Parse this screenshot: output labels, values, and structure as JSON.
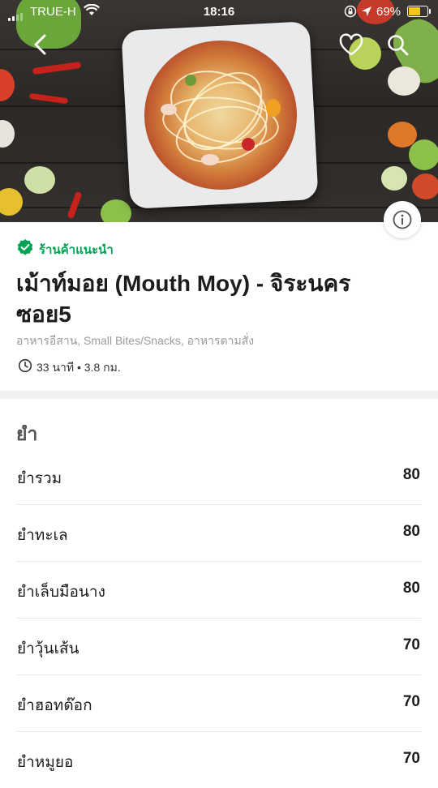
{
  "status_bar": {
    "carrier": "TRUE-H",
    "time": "18:16",
    "battery": "69%",
    "battery_level": 0.69
  },
  "header": {
    "icons": [
      "back-icon",
      "heart-icon",
      "search-icon",
      "info-icon"
    ]
  },
  "restaurant": {
    "recommended_label": "ร้านค้าแนะนำ",
    "name": "เม้าท์มอย (Mouth Moy) - จิระนครซอย5",
    "cuisines": "อาหารอีสาน, Small Bites/Snacks, อาหารตามสั่ง",
    "delivery_info": "33 นาที • 3.8 กม."
  },
  "colors": {
    "accent_green": "#00a452",
    "battery_yellow": "#f5c518"
  },
  "section": {
    "title": "ยำ"
  },
  "menu_items": [
    {
      "name": "ยำรวม",
      "price": "80"
    },
    {
      "name": "ยำทะเล",
      "price": "80"
    },
    {
      "name": "ยำเล็บมือนาง",
      "price": "80"
    },
    {
      "name": "ยำวุ้นเส้น",
      "price": "70"
    },
    {
      "name": "ยำฮอทด๊อก",
      "price": "70"
    },
    {
      "name": "ยำหมูยอ",
      "price": "70"
    }
  ]
}
